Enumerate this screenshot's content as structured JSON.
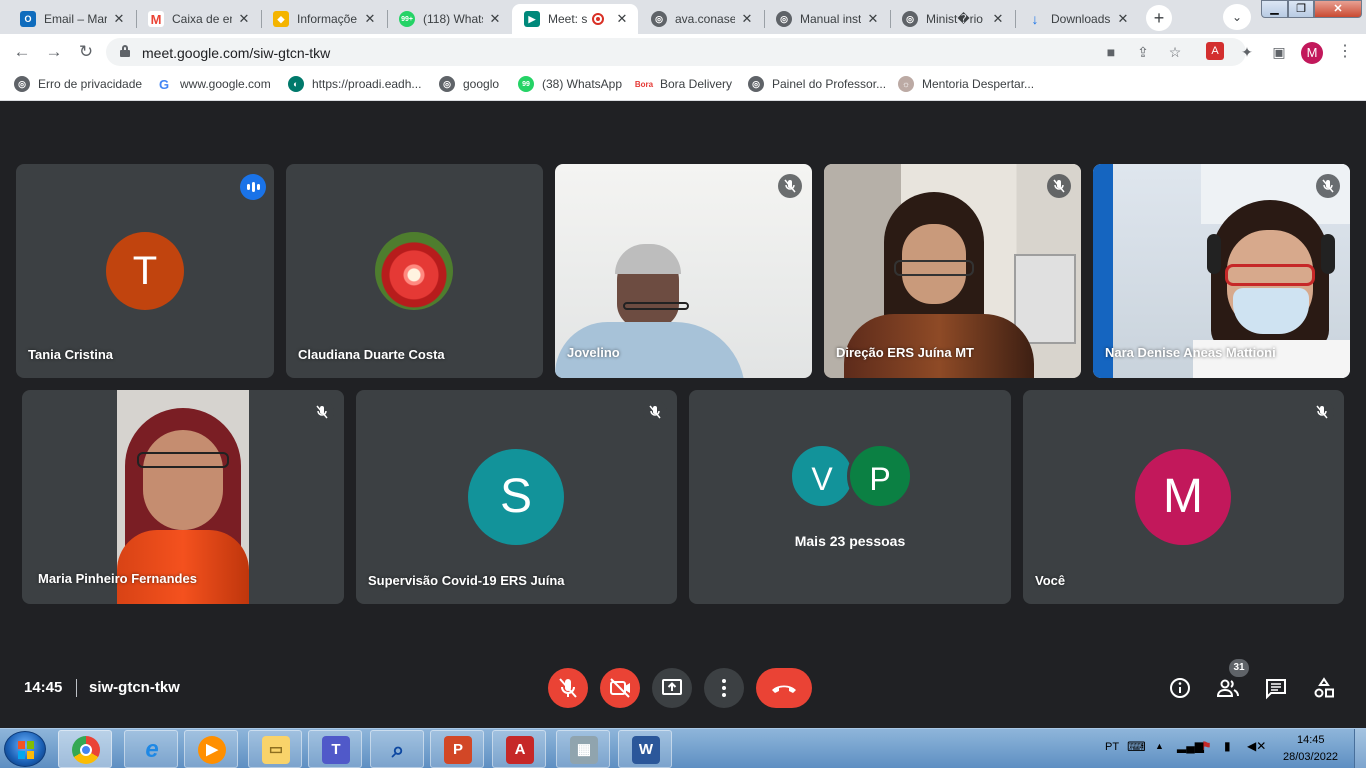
{
  "browser": {
    "tabs": [
      {
        "title": "Email – Mar",
        "favicon": "outlook-icon",
        "color": "#0f6cbd",
        "glyph": "O"
      },
      {
        "title": "Caixa de en",
        "favicon": "gmail-icon",
        "color": "#ea4335",
        "glyph": "M"
      },
      {
        "title": "Informaçõe",
        "favicon": "gov-icon",
        "color": "#f4b400",
        "glyph": "◆"
      },
      {
        "title": "(118) Whats",
        "favicon": "whatsapp-icon",
        "color": "#25d366",
        "glyph": "99+"
      },
      {
        "title": "Meet: s",
        "favicon": "meet-icon",
        "color": "#00897b",
        "glyph": "▶",
        "active": true
      },
      {
        "title": "ava.conaser",
        "favicon": "globe-icon",
        "color": "#5f6368",
        "glyph": "◎"
      },
      {
        "title": "Manual inst",
        "favicon": "globe-icon",
        "color": "#5f6368",
        "glyph": "◎"
      },
      {
        "title": "Minist�rio",
        "favicon": "globe-icon",
        "color": "#5f6368",
        "glyph": "◎"
      },
      {
        "title": "Downloads",
        "favicon": "download-icon",
        "color": "#1a73e8",
        "glyph": "↓"
      }
    ],
    "url": "meet.google.com/siw-gtcn-tkw",
    "profile_initial": "M",
    "bookmarks": [
      {
        "label": "Erro de privacidade",
        "icon": "globe-icon",
        "color": "#5f6368",
        "glyph": "◎"
      },
      {
        "label": "www.google.com",
        "icon": "google-icon",
        "color": "#4285f4",
        "glyph": "G"
      },
      {
        "label": "https://proadi.eadh...",
        "icon": "proadi-icon",
        "color": "#00796b",
        "glyph": "◐"
      },
      {
        "label": "googlo",
        "icon": "globe-icon",
        "color": "#5f6368",
        "glyph": "◎"
      },
      {
        "label": "(38) WhatsApp",
        "icon": "whatsapp-icon",
        "color": "#25d366",
        "glyph": "99"
      },
      {
        "label": "Bora Delivery",
        "icon": "bora-icon",
        "color": "#e53935",
        "glyph": "B"
      },
      {
        "label": "Painel do Professor...",
        "icon": "globe-icon",
        "color": "#5f6368",
        "glyph": "◎"
      },
      {
        "label": "Mentoria Despertar...",
        "icon": "mentoria-icon",
        "color": "#bcaaa4",
        "glyph": "☼"
      }
    ]
  },
  "meet": {
    "participants": [
      {
        "name": "Tania Cristina",
        "type": "avatar",
        "initial": "T",
        "color": "#c1440e",
        "speaking": true
      },
      {
        "name": "Claudiana Duarte Costa",
        "type": "photo-avatar"
      },
      {
        "name": "Jovelino",
        "type": "video",
        "muted": true
      },
      {
        "name": "Direção ERS Juína MT",
        "type": "video",
        "muted": true
      },
      {
        "name": "Nara Denise Aneas Mattioni",
        "type": "video",
        "muted": true
      },
      {
        "name": "Maria Pinheiro Fernandes",
        "type": "video",
        "muted": true
      },
      {
        "name": "Supervisão Covid-19 ERS Juína",
        "type": "avatar",
        "initial": "S",
        "color": "#12939a",
        "muted": true
      },
      {
        "name": "Mais 23 pessoas",
        "type": "group",
        "initials": [
          "V",
          "P"
        ],
        "colors": [
          "#12939a",
          "#0b8043"
        ]
      },
      {
        "name": "Você",
        "type": "avatar",
        "initial": "M",
        "color": "#c2185b",
        "muted": true
      }
    ],
    "time": "14:45",
    "meeting_code": "siw-gtcn-tkw",
    "participant_count": "31"
  },
  "taskbar": {
    "language": "PT",
    "time": "14:45",
    "date": "28/03/2022"
  }
}
